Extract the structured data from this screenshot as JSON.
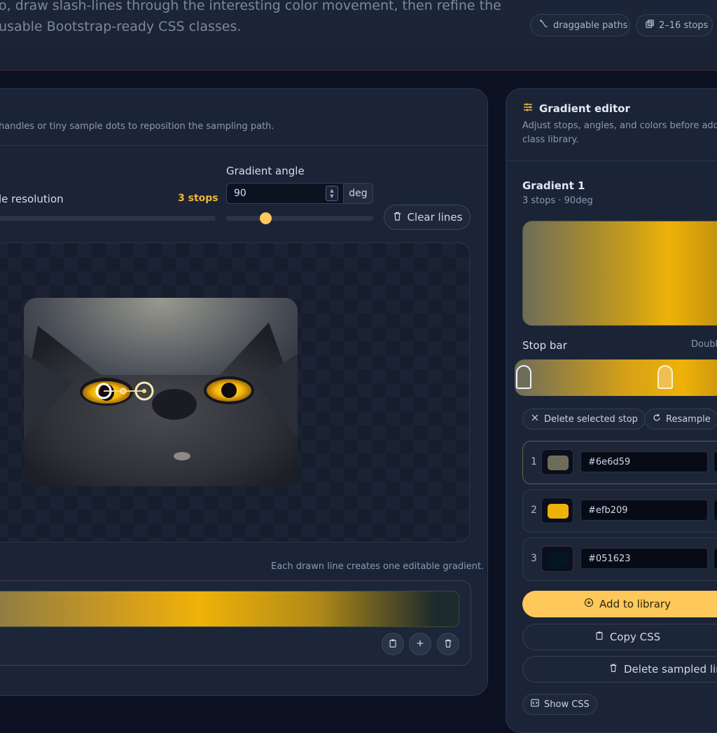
{
  "header": {
    "line1": "o, draw slash-lines through the interesting color movement, then refine the",
    "line2": "usable Bootstrap-ready CSS classes.",
    "badges": [
      {
        "label": "draggable paths",
        "icon": "path-icon"
      },
      {
        "label": "2–16 stops",
        "icon": "layers-icon"
      }
    ]
  },
  "sampler": {
    "hint": "handles or tiny sample dots to reposition the sampling path.",
    "resolution_label": "le resolution",
    "stops_count": "3 stops",
    "angle_label": "Gradient angle",
    "angle_value": "90",
    "angle_unit": "deg",
    "angle_slider_value": 90,
    "clear_label": "Clear lines",
    "line_caption": "Each drawn line creates one editable gradient."
  },
  "editor": {
    "title": "Gradient editor",
    "subtitle_line1": "Adjust stops, angles, and colors before addin",
    "subtitle_line2": "class library.",
    "gradient_name": "Gradient 1",
    "gradient_meta": "3 stops · 90deg",
    "stopbar_label": "Stop bar",
    "stopbar_hint": "Doubl",
    "delete_stop_label": "Delete selected stop",
    "resample_label": "Resample",
    "stops": [
      {
        "index": "1",
        "hex": "#6e6d59",
        "color": "#6e6d59"
      },
      {
        "index": "2",
        "hex": "#efb209",
        "color": "#efb209"
      },
      {
        "index": "3",
        "hex": "#051623",
        "color": "#051623"
      }
    ],
    "add_label": "Add to library",
    "copy_label": "Copy CSS",
    "delete_lines_label": "Delete sampled lin",
    "show_css_label": "Show CSS"
  },
  "colors": {
    "accent": "#ffc85a",
    "stop_yellow": "#efb209"
  }
}
